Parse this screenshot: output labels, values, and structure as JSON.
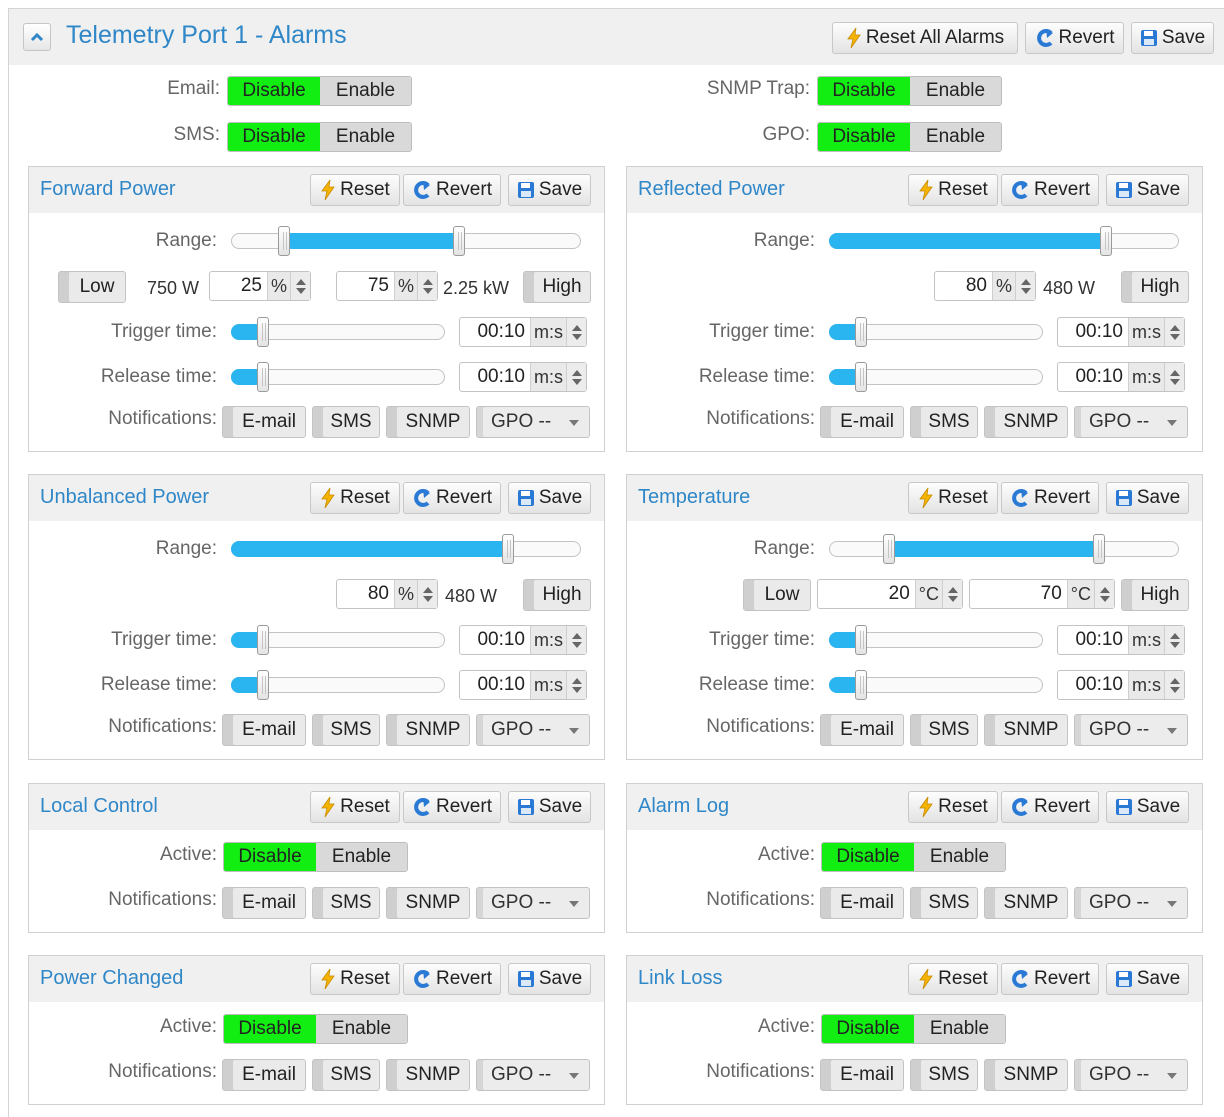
{
  "header": {
    "title": "Telemetry Port 1 - Alarms",
    "reset_all_label": "Reset All Alarms",
    "revert_label": "Revert",
    "save_label": "Save"
  },
  "global": {
    "email_label": "Email:",
    "sms_label": "SMS:",
    "snmp_label": "SNMP Trap:",
    "gpo_label": "GPO:",
    "disable_label": "Disable",
    "enable_label": "Enable",
    "selected": "Disable"
  },
  "common": {
    "reset_label": "Reset",
    "revert_label": "Revert",
    "save_label": "Save",
    "range_label": "Range:",
    "trigger_label": "Trigger time:",
    "release_label": "Release time:",
    "notifications_label": "Notifications:",
    "active_label": "Active:",
    "low_label": "Low",
    "high_label": "High",
    "time_unit": "m:s",
    "email_chip": "E-mail",
    "sms_chip": "SMS",
    "snmp_chip": "SNMP",
    "gpo_select": "GPO --",
    "disable_label": "Disable",
    "enable_label": "Enable"
  },
  "panels": {
    "forward": {
      "title": "Forward Power",
      "range_low_fraction": 0.15,
      "range_high_fraction": 0.65,
      "low_value": "750 W",
      "low_percent": "25",
      "high_percent": "75",
      "high_value": "2.25 kW",
      "unit": "%",
      "trigger": "00:10",
      "release": "00:10",
      "trigger_fraction": 0.12,
      "release_fraction": 0.12
    },
    "reflected": {
      "title": "Reflected Power",
      "range_high_fraction": 0.79,
      "high_percent": "80",
      "high_value": "480 W",
      "unit": "%",
      "trigger": "00:10",
      "release": "00:10",
      "trigger_fraction": 0.12,
      "release_fraction": 0.12
    },
    "unbalanced": {
      "title": "Unbalanced Power",
      "range_high_fraction": 0.79,
      "high_percent": "80",
      "high_value": "480 W",
      "unit": "%",
      "trigger": "00:10",
      "release": "00:10",
      "trigger_fraction": 0.12,
      "release_fraction": 0.12
    },
    "temperature": {
      "title": "Temperature",
      "range_low_fraction": 0.17,
      "range_high_fraction": 0.77,
      "low_value": "20",
      "high_value": "70",
      "unit": "°C",
      "trigger": "00:10",
      "release": "00:10",
      "trigger_fraction": 0.12,
      "release_fraction": 0.12
    },
    "local_control": {
      "title": "Local Control",
      "active": "Disable"
    },
    "alarm_log": {
      "title": "Alarm Log",
      "active": "Disable"
    },
    "power_changed": {
      "title": "Power Changed",
      "active": "Disable"
    },
    "link_loss": {
      "title": "Link Loss",
      "active": "Disable"
    }
  },
  "colors": {
    "title_blue": "#2f87c8",
    "active_green": "#12ee12",
    "slider_fill": "#2bb5f0",
    "reset_bolt": "#f4b400",
    "revert_icon": "#2a7ad5",
    "save_icon": "#2a7ad5"
  },
  "icons": {
    "collapse": "chevron-up-icon",
    "reset": "lightning-icon",
    "revert": "undo-arrow-icon",
    "save": "floppy-disk-icon"
  }
}
